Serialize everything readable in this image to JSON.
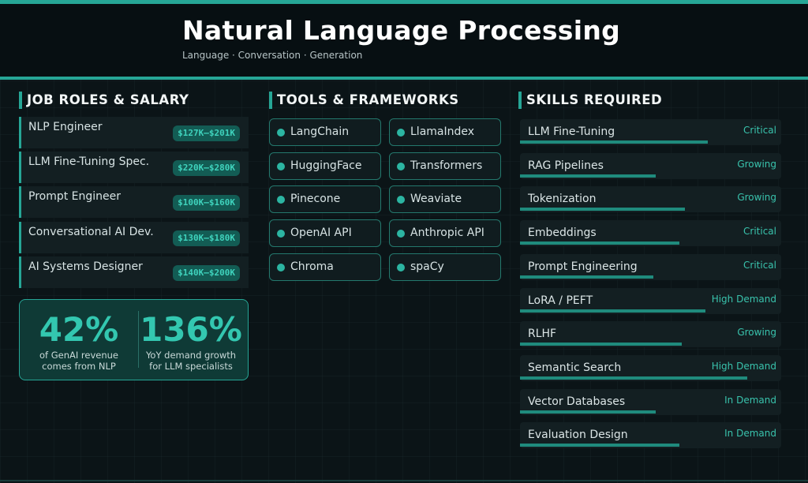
{
  "header": {
    "title": "Natural Language Processing",
    "subtitle": "Language · Conversation · Generation"
  },
  "sections": {
    "jobs": "JOB ROLES & SALARY",
    "tools": "TOOLS & FRAMEWORKS",
    "skills": "SKILLS REQUIRED"
  },
  "jobs": [
    {
      "title": "NLP Engineer",
      "salary": "$127K–$201K"
    },
    {
      "title": "LLM Fine-Tuning Spec.",
      "salary": "$220K–$280K"
    },
    {
      "title": "Prompt Engineer",
      "salary": "$100K–$160K"
    },
    {
      "title": "Conversational AI Dev.",
      "salary": "$130K–$180K"
    },
    {
      "title": "AI Systems Designer",
      "salary": "$140K–$200K"
    }
  ],
  "stats": [
    {
      "value": "42%",
      "label_line1": "of GenAI revenue",
      "label_line2": "comes from NLP"
    },
    {
      "value": "136%",
      "label_line1": "YoY demand growth",
      "label_line2": "for LLM specialists"
    }
  ],
  "tools": [
    "LangChain",
    "LlamaIndex",
    "HuggingFace",
    "Transformers",
    "Pinecone",
    "Weaviate",
    "OpenAI API",
    "Anthropic API",
    "Chroma",
    "spaCy"
  ],
  "skills": [
    {
      "name": "LLM Fine-Tuning",
      "status": "Critical",
      "level": 0.72
    },
    {
      "name": "RAG Pipelines",
      "status": "Growing",
      "level": 0.52
    },
    {
      "name": "Tokenization",
      "status": "Growing",
      "level": 0.63
    },
    {
      "name": "Embeddings",
      "status": "Critical",
      "level": 0.61
    },
    {
      "name": "Prompt Engineering",
      "status": "Critical",
      "level": 0.51
    },
    {
      "name": "LoRA / PEFT",
      "status": "High Demand",
      "level": 0.71
    },
    {
      "name": "RLHF",
      "status": "Growing",
      "level": 0.62
    },
    {
      "name": "Semantic Search",
      "status": "High Demand",
      "level": 0.87
    },
    {
      "name": "Vector Databases",
      "status": "In Demand",
      "level": 0.52
    },
    {
      "name": "Evaluation Design",
      "status": "In Demand",
      "level": 0.61
    }
  ],
  "colors": {
    "accent": "#26a696",
    "background": "#0b1417",
    "badge_bg": "#135c54",
    "badge_text": "#3fd3bd"
  }
}
